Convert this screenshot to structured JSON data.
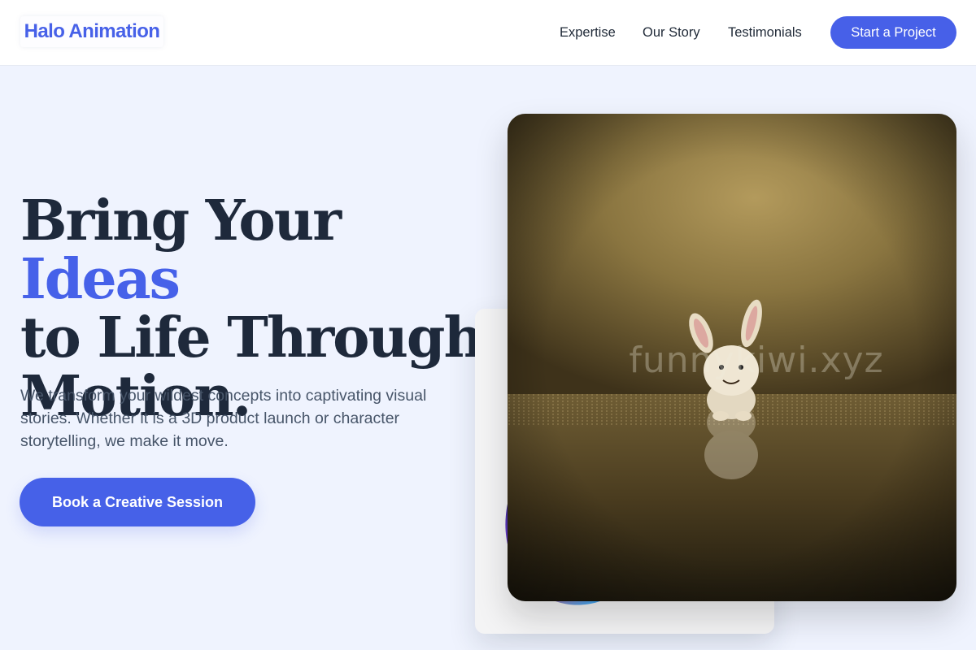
{
  "brand": {
    "name": "Halo Animation",
    "accent_color": "#4661e8"
  },
  "nav": {
    "links": [
      {
        "label": "Expertise"
      },
      {
        "label": "Our Story"
      },
      {
        "label": "Testimonials"
      }
    ],
    "cta_label": "Start a Project"
  },
  "hero": {
    "headline": {
      "line1_start": "Bring Your ",
      "line1_accent": "Ideas",
      "line2": "to Life Through",
      "line3": "Motion."
    },
    "subtext": "We transform your wildest concepts into captivating visual stories. Whether it is a 3D product launch or character storytelling, we make it move.",
    "cta_label": "Book a Creative Session"
  },
  "visuals": {
    "main_image": {
      "subject": "toy-bunny-on-reflective-floor",
      "watermark": "funnykiwi.xyz"
    },
    "back_card": {
      "subject": "iridescent-fluid-3d-shape"
    }
  }
}
